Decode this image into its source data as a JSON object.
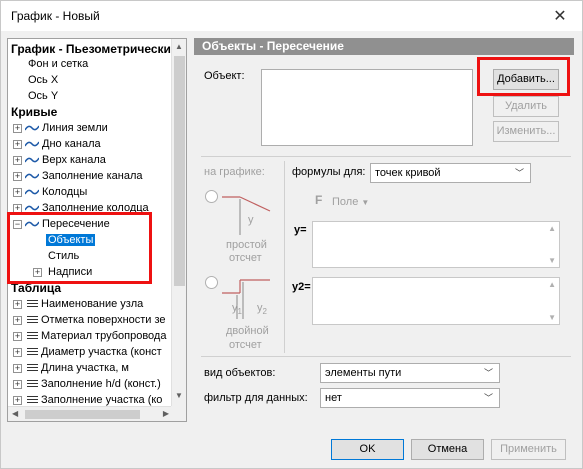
{
  "window": {
    "title": "График - Новый",
    "close_icon": "close-icon"
  },
  "tree": {
    "section_graph": "График - Пьезометрически",
    "graph_items": [
      "Фон и сетка",
      "Ось X",
      "Ось Y"
    ],
    "section_curves": "Кривые",
    "curve_items": [
      "Линия земли",
      "Дно канала",
      "Верх канала",
      "Заполнение канала",
      "Колодцы",
      "Заполнение колодца"
    ],
    "intersection": "Пересечение",
    "intersection_children": [
      "Объекты",
      "Стиль",
      "Надписи"
    ],
    "section_table": "Таблица",
    "table_items": [
      "Наименование узла",
      "Отметка поверхности зе",
      "Материал трубопровода",
      "Диаметр участка (конст",
      "Длина участка, м",
      "Заполнение h/d (конст.)",
      "Заполнение участка (ко"
    ]
  },
  "panel": {
    "header": "Объекты - Пересечение",
    "object_label": "Объект:",
    "add_button": "Добавить...",
    "delete_button": "Удалить",
    "edit_button": "Изменить...",
    "on_graph_label": "на графике:",
    "formulas_for_label": "формулы для:",
    "formulas_for_value": "точек кривой",
    "field_icon": "F",
    "field_label": "Поле",
    "y_label": "y",
    "simple_ref_label_1": "простой",
    "simple_ref_label_2": "отсчет",
    "y1_label": "y",
    "y1_sub": "1",
    "y2_label": "y",
    "y2_sub": "2",
    "double_ref_label_1": "двойной",
    "double_ref_label_2": "отсчет",
    "formula_y": "y=",
    "formula_y2": "y2=",
    "object_type_label": "вид объектов:",
    "object_type_value": "элементы пути",
    "data_filter_label": "фильтр для данных:",
    "data_filter_value": "нет"
  },
  "footer": {
    "ok": "OK",
    "cancel": "Отмена",
    "apply": "Применить"
  },
  "colors": {
    "highlight": "#ee1111",
    "selection": "#0078d7",
    "header_bg": "#909090"
  }
}
